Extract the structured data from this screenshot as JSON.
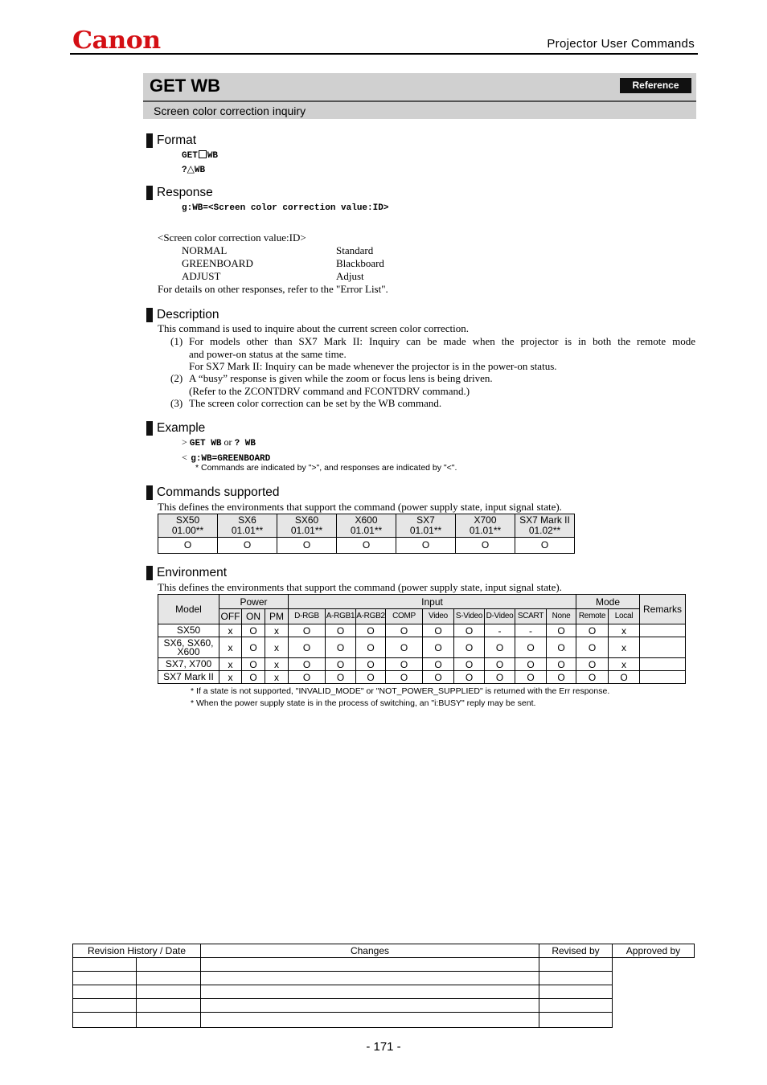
{
  "header": {
    "brand": "Canon",
    "brand_color": "#d40f14",
    "document_title": "Projector User Commands"
  },
  "command": {
    "name": "GET WB",
    "badge": "Reference",
    "subtitle": "Screen color correction inquiry"
  },
  "format": {
    "heading": "Format",
    "lines": [
      {
        "pre": "GET",
        "separator_icon": "space-box-icon",
        "post": "WB"
      },
      {
        "pre": "?",
        "separator_icon": "triangle-icon",
        "separator_glyph": "△",
        "post": "WB"
      }
    ]
  },
  "response": {
    "heading": "Response",
    "syntax": "g:WB=<Screen color correction value:ID>",
    "value_label": "<Screen color correction value:ID>",
    "values": [
      {
        "id": "NORMAL",
        "meaning": "Standard"
      },
      {
        "id": "GREENBOARD",
        "meaning": "Blackboard"
      },
      {
        "id": "ADJUST",
        "meaning": "Adjust"
      }
    ],
    "note": "For details on other responses, refer to the \"Error List\"."
  },
  "description": {
    "heading": "Description",
    "intro": "This command is used to inquire about the current screen color correction.",
    "items": [
      {
        "num": "(1)",
        "lines": [
          "For models other than SX7 Mark II: Inquiry can be made when the projector is in both the remote mode",
          "and power-on status at the same time.",
          "For SX7 Mark II: Inquiry can be made whenever the projector is in the power-on status."
        ]
      },
      {
        "num": "(2)",
        "lines": [
          "A “busy” response is given while the zoom or focus lens is being driven.",
          "(Refer to the ZCONTDRV command and FCONTDRV command.)"
        ]
      },
      {
        "num": "(3)",
        "lines": [
          "The screen color correction can be set by the WB command."
        ]
      }
    ]
  },
  "example": {
    "heading": "Example",
    "cmd_prefix": ">",
    "cmd_a": "GET WB",
    "or": "or",
    "cmd_b": "? WB",
    "resp_prefix": "<",
    "resp": "g:WB=GREENBOARD",
    "note": "* Commands are indicated by \">\", and responses are indicated by \"<\"."
  },
  "commands_supported": {
    "heading": "Commands supported",
    "intro": "This defines the environments that support the command (power supply state, input signal state).",
    "models": [
      {
        "model": "SX50",
        "version": "01.00**",
        "supported": "O"
      },
      {
        "model": "SX6",
        "version": "01.01**",
        "supported": "O"
      },
      {
        "model": "SX60",
        "version": "01.01**",
        "supported": "O"
      },
      {
        "model": "X600",
        "version": "01.01**",
        "supported": "O"
      },
      {
        "model": "SX7",
        "version": "01.01**",
        "supported": "O"
      },
      {
        "model": "X700",
        "version": "01.01**",
        "supported": "O"
      },
      {
        "model": "SX7 Mark II",
        "version": "01.02**",
        "supported": "O"
      }
    ]
  },
  "environment": {
    "heading": "Environment",
    "intro": "This defines the environments that support the command (power supply state, input signal state).",
    "groups": {
      "model": "Model",
      "power": "Power",
      "input": "Input",
      "mode": "Mode",
      "remarks": "Remarks"
    },
    "columns": [
      "OFF",
      "ON",
      "PM",
      "D-RGB",
      "A-RGB1",
      "A-RGB2",
      "COMP",
      "Video",
      "S-Video",
      "D-Video",
      "SCART",
      "None",
      "Remote",
      "Local"
    ],
    "rows": [
      {
        "model": "SX50",
        "values": [
          "x",
          "O",
          "x",
          "O",
          "O",
          "O",
          "O",
          "O",
          "O",
          "-",
          "-",
          "O",
          "O",
          "x"
        ],
        "remarks": ""
      },
      {
        "model": "SX6, SX60, X600",
        "values": [
          "x",
          "O",
          "x",
          "O",
          "O",
          "O",
          "O",
          "O",
          "O",
          "O",
          "O",
          "O",
          "O",
          "x"
        ],
        "remarks": ""
      },
      {
        "model": "SX7, X700",
        "values": [
          "x",
          "O",
          "x",
          "O",
          "O",
          "O",
          "O",
          "O",
          "O",
          "O",
          "O",
          "O",
          "O",
          "x"
        ],
        "remarks": ""
      },
      {
        "model": "SX7 Mark II",
        "values": [
          "x",
          "O",
          "x",
          "O",
          "O",
          "O",
          "O",
          "O",
          "O",
          "O",
          "O",
          "O",
          "O",
          "O"
        ],
        "remarks": ""
      }
    ],
    "notes": [
      "*   If a state is not supported, \"INVALID_MODE\" or \"NOT_POWER_SUPPLIED\" is returned with the Err response.",
      "*   When the power supply state is in the process of switching, an \"i:BUSY\" reply may be sent."
    ]
  },
  "revision": {
    "headers": {
      "history": "Revision History / Date",
      "changes": "Changes",
      "revised_by": "Revised by",
      "approved_by": "Approved by"
    },
    "rows": [
      {
        "rev": "",
        "date": "",
        "changes": "",
        "revised_by": ""
      },
      {
        "rev": "",
        "date": "",
        "changes": "",
        "revised_by": ""
      },
      {
        "rev": "",
        "date": "",
        "changes": "",
        "revised_by": ""
      },
      {
        "rev": "",
        "date": "",
        "changes": "",
        "revised_by": ""
      },
      {
        "rev": "",
        "date": "",
        "changes": "",
        "revised_by": ""
      }
    ],
    "approved_by": ""
  },
  "footer": {
    "page_number": "- 171 -"
  }
}
